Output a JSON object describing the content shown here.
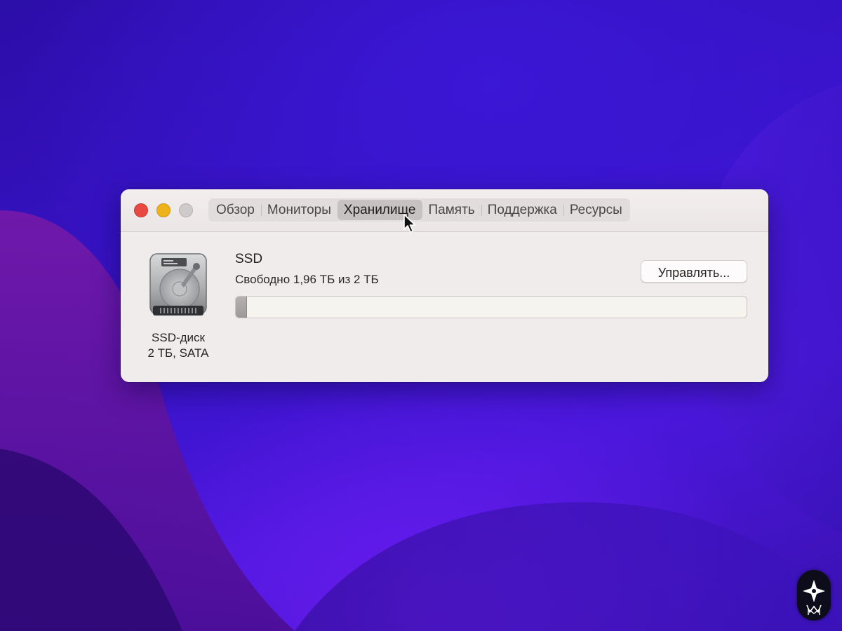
{
  "window": {
    "tabs": [
      {
        "label": "Обзор",
        "active": false
      },
      {
        "label": "Мониторы",
        "active": false
      },
      {
        "label": "Хранилище",
        "active": true
      },
      {
        "label": "Память",
        "active": false
      },
      {
        "label": "Поддержка",
        "active": false
      },
      {
        "label": "Ресурсы",
        "active": false
      }
    ]
  },
  "disk": {
    "icon": "ssd-drive-icon",
    "name_line1": "SSD-диск",
    "name_line2": "2 ТБ, SATA"
  },
  "volume": {
    "name": "SSD",
    "free_text": "Свободно 1,96 ТБ из 2 ТБ",
    "manage_button_label": "Управлять...",
    "used_fraction": 0.02
  },
  "colors": {
    "close": "#e94a3f",
    "minimize": "#eeb21c",
    "zoom_inactive": "#cfcaca"
  }
}
